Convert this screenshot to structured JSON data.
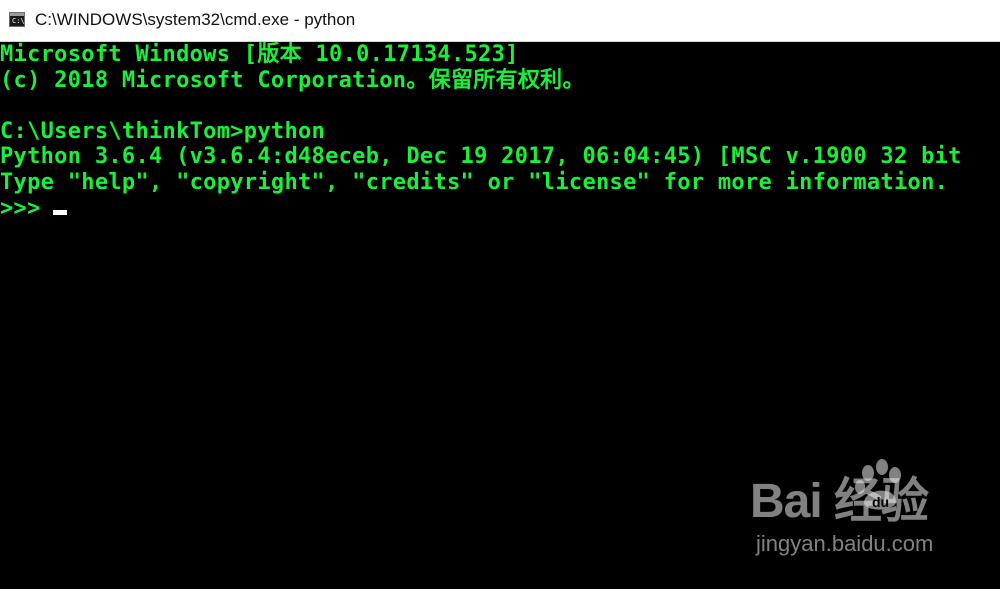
{
  "window": {
    "title": "C:\\WINDOWS\\system32\\cmd.exe - python",
    "icon": "cmd-icon",
    "icon_text": "C:\\"
  },
  "terminal": {
    "colors": {
      "background": "#000000",
      "text": "#18f03a",
      "cursor": "#ffffff"
    },
    "lines": [
      "Microsoft Windows [版本 10.0.17134.523]",
      "(c) 2018 Microsoft Corporation。保留所有权利。",
      "",
      "C:\\Users\\thinkTom>python",
      "Python 3.6.4 (v3.6.4:d48eceb, Dec 19 2017, 06:04:45) [MSC v.1900 32 bit",
      "Type \"help\", \"copyright\", \"credits\" or \"license\" for more information.",
      ">>>"
    ]
  },
  "watermark": {
    "logo_text": "Bai  经验",
    "url": "jingyan.baidu.com"
  }
}
